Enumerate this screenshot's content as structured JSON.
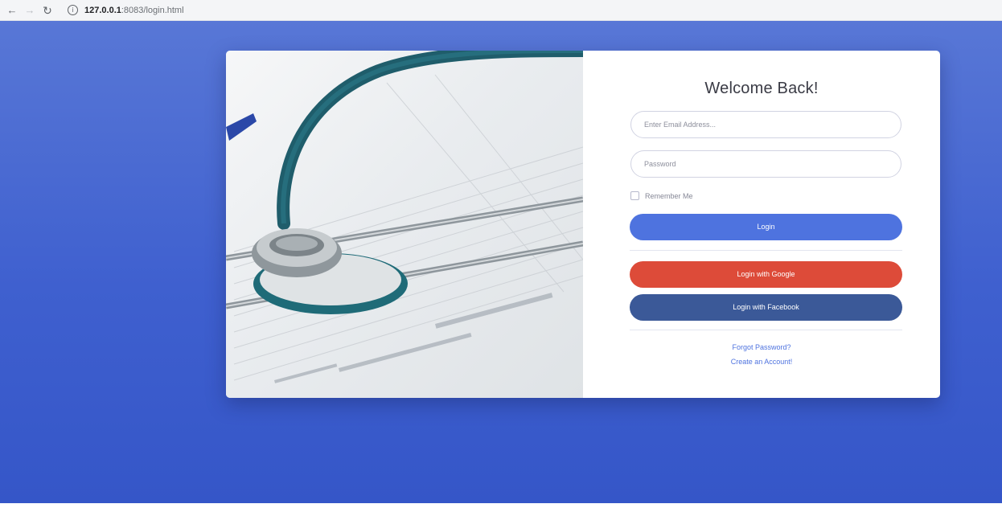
{
  "browser": {
    "back_icon": "back-arrow-icon",
    "forward_icon": "forward-arrow-icon",
    "reload_icon": "reload-icon",
    "info_icon": "info-icon",
    "url_host": "127.0.0.1",
    "url_path": ":8083/login.html"
  },
  "login": {
    "title": "Welcome Back!",
    "email_placeholder": "Enter Email Address...",
    "password_placeholder": "Password",
    "remember_label": "Remember Me",
    "login_button": "Login",
    "google_button": "Login with Google",
    "facebook_button": "Login with Facebook",
    "forgot_link": "Forgot Password?",
    "create_link": "Create an Account!"
  },
  "colors": {
    "background": "#4e73df",
    "primary": "#4e73df",
    "google": "#dd4b39",
    "facebook": "#3b5998"
  }
}
